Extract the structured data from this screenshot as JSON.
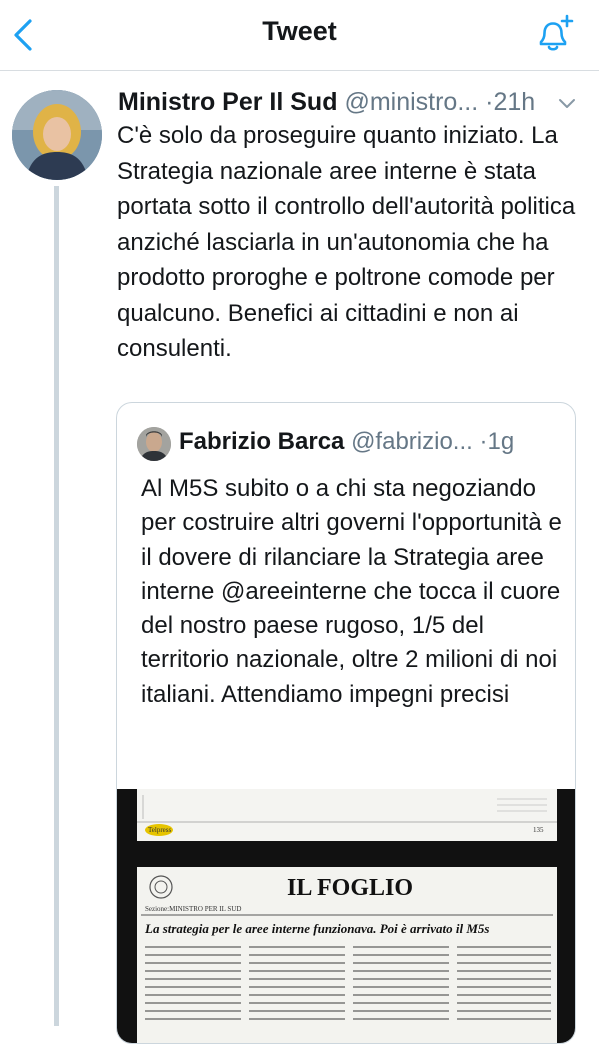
{
  "header": {
    "title": "Tweet",
    "back_icon": "chevron-left-icon",
    "bell_icon": "bell-plus-icon",
    "accent_color": "#1da1f2"
  },
  "tweet": {
    "author_name": "Ministro Per Il Sud",
    "author_handle": "@ministro...",
    "time": "21h",
    "text": "C'è solo da proseguire quanto iniziato. La Strategia nazionale aree interne è stata portata sotto il controllo dell'autorità politica anziché lasciarla in un'autonomia che ha prodotto proroghe e poltrone comode per qualcuno. Benefici ai cittadini e non ai consulenti."
  },
  "quote": {
    "author_name": "Fabrizio Barca",
    "author_handle": "@fabrizio...",
    "time": "1g",
    "text": "Al M5S subito o a chi sta negoziando per costruire altri governi l'opportunità e il dovere di rilanciare la Strategia aree interne @areeinterne che tocca il cuore del nostro paese rugoso, 1/5 del territorio nazionale, oltre 2 milioni di noi italiani. Attendiamo impegni precisi",
    "clipping": {
      "logo_text": "Telpress",
      "page_label": "135",
      "newspaper": "IL FOGLIO",
      "section": "Sezione:MINISTRO PER IL SUD",
      "headline": "La strategia per le aree interne funzionava. Poi è arrivato il M5s"
    }
  }
}
